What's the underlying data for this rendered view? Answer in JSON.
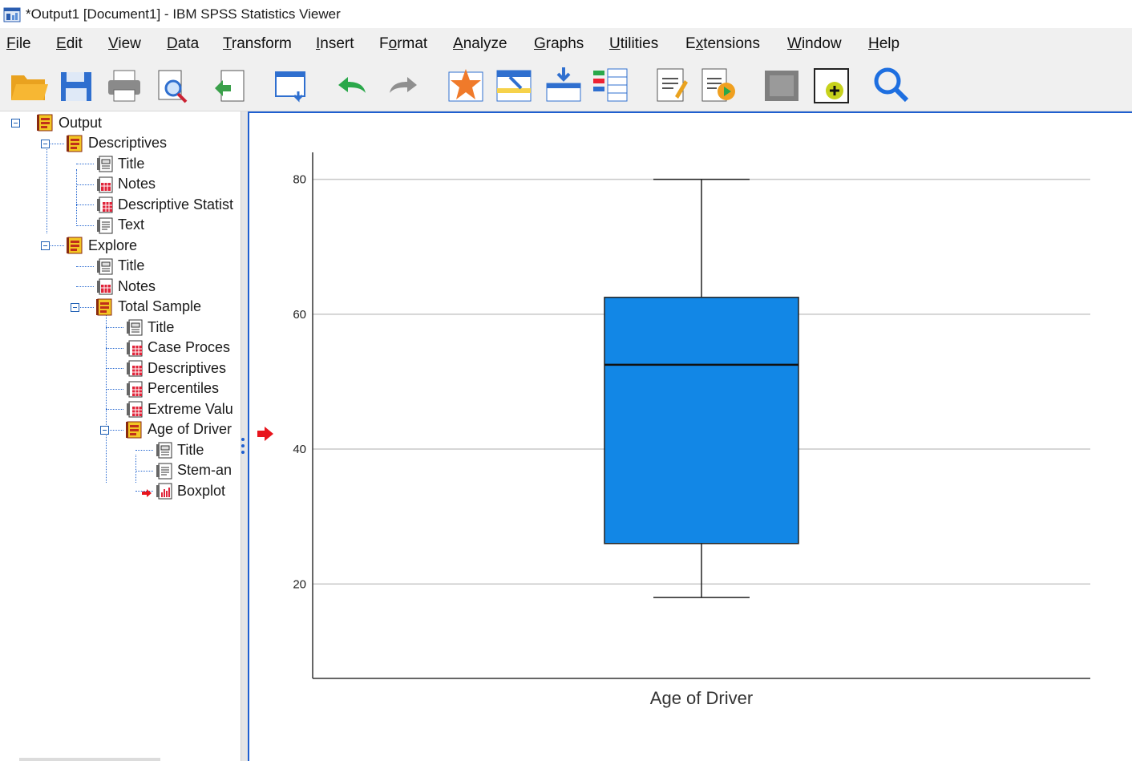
{
  "window": {
    "title": "*Output1 [Document1] - IBM SPSS Statistics Viewer"
  },
  "menu": [
    {
      "id": "file",
      "label": "File",
      "mnemonic": "F",
      "rest": "ile"
    },
    {
      "id": "edit",
      "label": "Edit",
      "mnemonic": "E",
      "rest": "dit"
    },
    {
      "id": "view",
      "label": "View",
      "mnemonic": "V",
      "rest": "iew"
    },
    {
      "id": "data",
      "label": "Data",
      "mnemonic": "D",
      "rest": "ata"
    },
    {
      "id": "transform",
      "label": "Transform",
      "mnemonic": "T",
      "rest": "ransform"
    },
    {
      "id": "insert",
      "label": "Insert",
      "mnemonic": "I",
      "rest": "nsert"
    },
    {
      "id": "format",
      "label": "Format",
      "mnemonic": "o",
      "pre": "F",
      "rest": "rmat"
    },
    {
      "id": "analyze",
      "label": "Analyze",
      "mnemonic": "A",
      "rest": "nalyze"
    },
    {
      "id": "graphs",
      "label": "Graphs",
      "mnemonic": "G",
      "rest": "raphs"
    },
    {
      "id": "utilities",
      "label": "Utilities",
      "mnemonic": "U",
      "rest": "tilities"
    },
    {
      "id": "extensions",
      "label": "Extensions",
      "mnemonic": "x",
      "pre": "E",
      "rest": "tensions"
    },
    {
      "id": "window",
      "label": "Window",
      "mnemonic": "W",
      "rest": "indow"
    },
    {
      "id": "help",
      "label": "Help",
      "mnemonic": "H",
      "rest": "elp"
    }
  ],
  "toolbar": [
    {
      "id": "open",
      "icon": "folder-open-icon"
    },
    {
      "id": "save",
      "icon": "save-disk-icon"
    },
    {
      "id": "print",
      "icon": "printer-icon"
    },
    {
      "id": "print-preview",
      "icon": "print-preview-icon"
    },
    {
      "id": "export",
      "icon": "export-icon"
    },
    {
      "id": "recall-dialog",
      "icon": "recall-dialog-icon"
    },
    {
      "id": "undo",
      "icon": "undo-icon"
    },
    {
      "id": "redo",
      "icon": "redo-icon"
    },
    {
      "id": "goto-data",
      "icon": "goto-data-icon"
    },
    {
      "id": "goto-case",
      "icon": "goto-case-icon"
    },
    {
      "id": "goto-variable",
      "icon": "goto-variable-icon"
    },
    {
      "id": "variables",
      "icon": "variables-icon"
    },
    {
      "id": "designate-window",
      "icon": "designate-window-icon"
    },
    {
      "id": "run-script",
      "icon": "run-script-icon"
    },
    {
      "id": "create-edit-autoscript",
      "icon": "autoscript-icon"
    },
    {
      "id": "insert-output",
      "icon": "insert-output-icon"
    },
    {
      "id": "search",
      "icon": "search-icon"
    }
  ],
  "tree": [
    {
      "id": "output",
      "label": "Output",
      "icon": "book-icon",
      "level": 0,
      "toggle": true
    },
    {
      "id": "descriptives",
      "label": "Descriptives",
      "icon": "book-icon",
      "level": 1,
      "toggle": true
    },
    {
      "id": "desc-title",
      "label": "Title",
      "icon": "title-icon",
      "level": 2
    },
    {
      "id": "desc-notes",
      "label": "Notes",
      "icon": "notes-icon",
      "level": 2
    },
    {
      "id": "desc-stats",
      "label": "Descriptive Statist",
      "icon": "table-icon",
      "level": 2
    },
    {
      "id": "desc-text",
      "label": "Text",
      "icon": "text-icon",
      "level": 2
    },
    {
      "id": "explore",
      "label": "Explore",
      "icon": "book-icon",
      "level": 1,
      "toggle": true
    },
    {
      "id": "exp-title",
      "label": "Title",
      "icon": "title-icon",
      "level": 2
    },
    {
      "id": "exp-notes",
      "label": "Notes",
      "icon": "notes-icon",
      "level": 2
    },
    {
      "id": "total-sample",
      "label": "Total Sample",
      "icon": "book-icon",
      "level": 2,
      "toggle": true
    },
    {
      "id": "ts-title",
      "label": "Title",
      "icon": "title-icon",
      "level": 3
    },
    {
      "id": "ts-case",
      "label": "Case Proces",
      "icon": "table-icon",
      "level": 3
    },
    {
      "id": "ts-desc",
      "label": "Descriptives",
      "icon": "table-icon",
      "level": 3
    },
    {
      "id": "ts-pct",
      "label": "Percentiles",
      "icon": "table-icon",
      "level": 3
    },
    {
      "id": "ts-extreme",
      "label": "Extreme Valu",
      "icon": "table-icon",
      "level": 3
    },
    {
      "id": "age-driver",
      "label": "Age of Driver",
      "icon": "book-icon",
      "level": 3,
      "toggle": true
    },
    {
      "id": "ad-title",
      "label": "Title",
      "icon": "title-icon",
      "level": 4
    },
    {
      "id": "ad-stem",
      "label": "Stem-an",
      "icon": "text-icon",
      "level": 4
    },
    {
      "id": "ad-boxplot",
      "label": "Boxplot",
      "icon": "chart-icon",
      "level": 4,
      "selected": true
    }
  ],
  "colors": {
    "box_fill": "#1287e6",
    "selection_arrow": "#e8141c",
    "pane_border": "#1f5fd0"
  },
  "chart_data": {
    "type": "boxplot",
    "xlabel": "Age of Driver",
    "categories": [
      "Age of Driver"
    ],
    "yticks": [
      20,
      40,
      60,
      80
    ],
    "ylim": [
      6,
      84
    ],
    "grid": true,
    "boxes": [
      {
        "category": "Age of Driver",
        "min": 18,
        "q1": 26,
        "median": 52.5,
        "q3": 62.5,
        "max": 80
      }
    ]
  }
}
